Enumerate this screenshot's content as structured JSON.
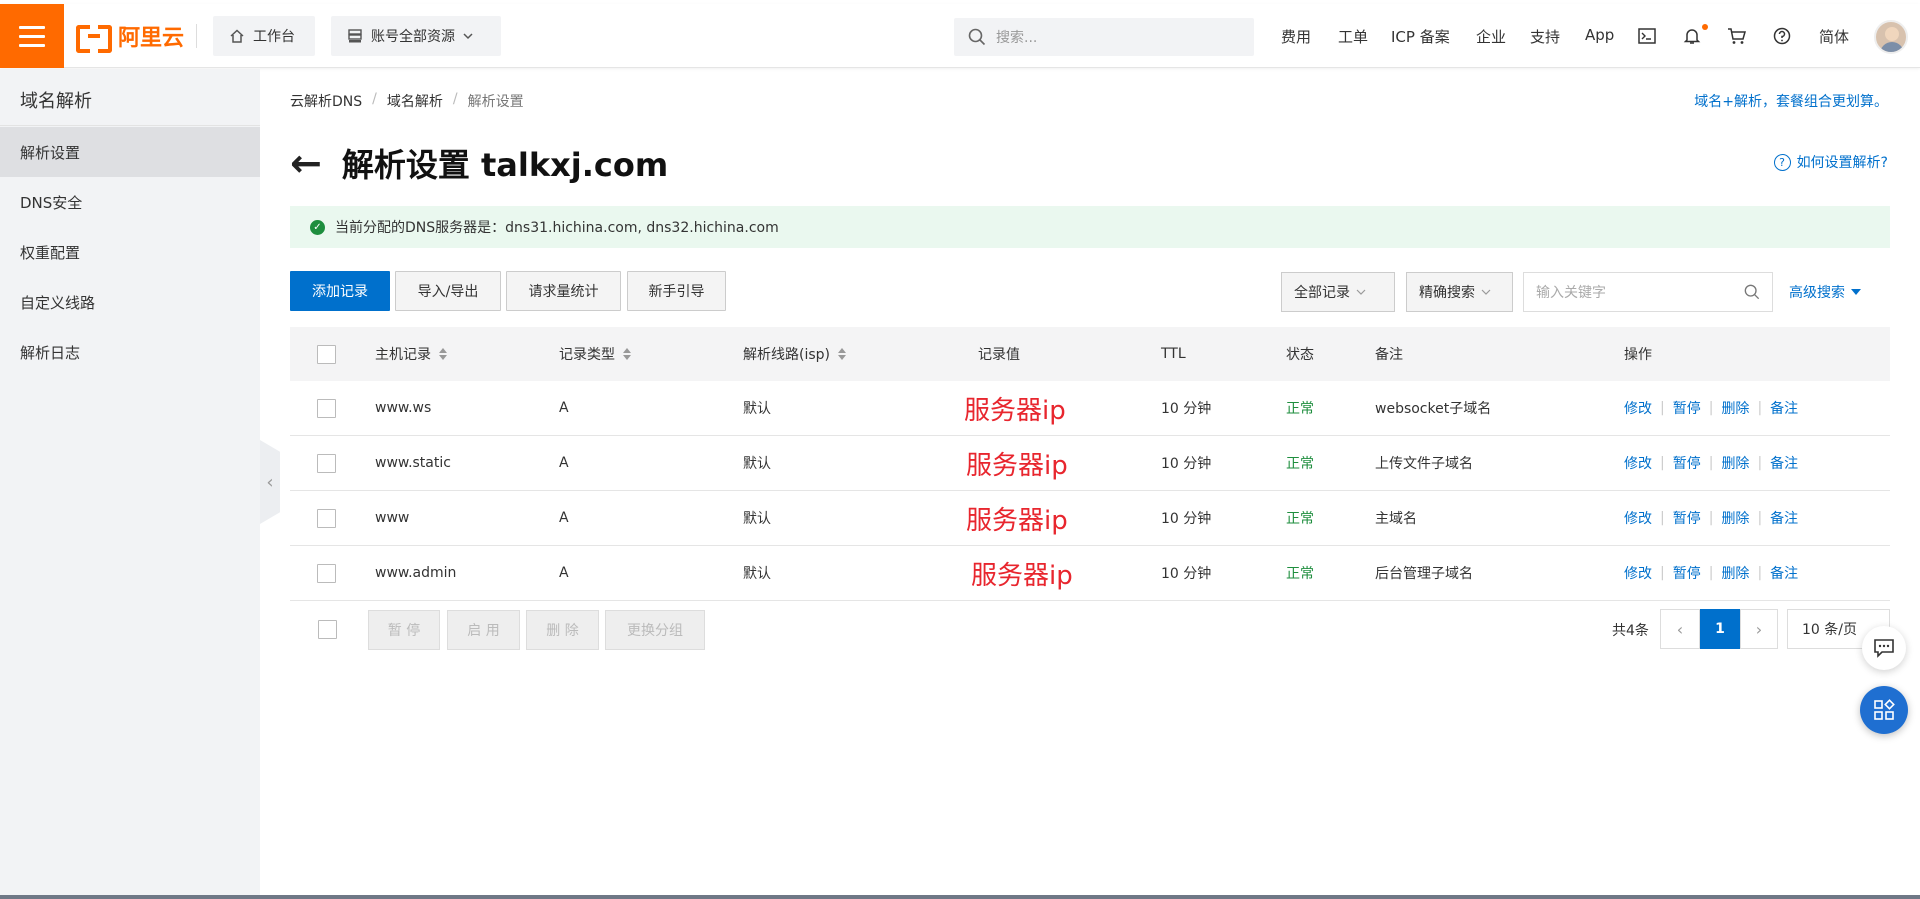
{
  "header": {
    "logo_text": "阿里云",
    "workbench_label": "工作台",
    "resources_label": "账号全部资源",
    "search_placeholder": "搜索...",
    "nav_links": [
      "费用",
      "工单",
      "ICP 备案",
      "企业",
      "支持",
      "App"
    ],
    "lang_label": "简体",
    "icons": [
      "terminal-icon",
      "bell-icon",
      "cart-icon",
      "help-icon"
    ]
  },
  "sidebar": {
    "title": "域名解析",
    "items": [
      {
        "label": "解析设置",
        "active": true
      },
      {
        "label": "DNS安全",
        "active": false
      },
      {
        "label": "权重配置",
        "active": false
      },
      {
        "label": "自定义线路",
        "active": false
      },
      {
        "label": "解析日志",
        "active": false
      }
    ]
  },
  "breadcrumb": [
    "云解析DNS",
    "域名解析",
    "解析设置"
  ],
  "promo_text": "域名+解析，套餐组合更划算。",
  "page_title": "解析设置 talkxj.com",
  "help_text": "如何设置解析?",
  "notice_text": "当前分配的DNS服务器是：dns31.hichina.com, dns32.hichina.com",
  "toolbar": {
    "add_label": "添加记录",
    "import_label": "导入/导出",
    "stats_label": "请求量统计",
    "guide_label": "新手引导",
    "filter_all": "全部记录",
    "filter_exact": "精确搜索",
    "keyword_placeholder": "输入关键字",
    "advanced_label": "高级搜索"
  },
  "table": {
    "headers": {
      "host": "主机记录",
      "type": "记录类型",
      "line": "解析线路(isp)",
      "value": "记录值",
      "ttl": "TTL",
      "status": "状态",
      "remark": "备注",
      "ops": "操作"
    },
    "rows": [
      {
        "host": "www.ws",
        "type": "A",
        "line": "默认",
        "value": "服务器ip",
        "ttl": "10 分钟",
        "status": "正常",
        "remark": "websocket子域名"
      },
      {
        "host": "www.static",
        "type": "A",
        "line": "默认",
        "value": "服务器ip",
        "ttl": "10 分钟",
        "status": "正常",
        "remark": "上传文件子域名"
      },
      {
        "host": "www",
        "type": "A",
        "line": "默认",
        "value": "服务器ip",
        "ttl": "10 分钟",
        "status": "正常",
        "remark": "主域名"
      },
      {
        "host": "www.admin",
        "type": "A",
        "line": "默认",
        "value": "服务器ip",
        "ttl": "10 分钟",
        "status": "正常",
        "remark": "后台管理子域名"
      }
    ],
    "ops": {
      "edit": "修改",
      "pause": "暂停",
      "delete": "删除",
      "note": "备注"
    }
  },
  "bulk": {
    "pause": "暂 停",
    "enable": "启 用",
    "delete": "删 除",
    "regroup": "更换分组"
  },
  "pagination": {
    "total": "共4条",
    "current": "1",
    "page_size": "10 条/页"
  },
  "colors": {
    "brand": "#ff6a00",
    "primary": "#0070cc",
    "ok": "#1e8e3e",
    "ip_red": "#e8262e"
  }
}
